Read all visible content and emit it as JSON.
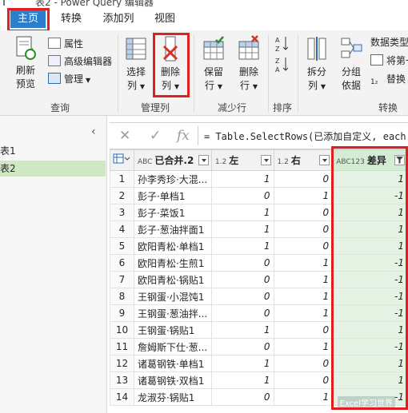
{
  "window": {
    "title": "表2 - Power Query 编辑器"
  },
  "tabs": [
    {
      "label": "主页",
      "active": true
    },
    {
      "label": "转换",
      "active": false
    },
    {
      "label": "添加列",
      "active": false
    },
    {
      "label": "视图",
      "active": false
    }
  ],
  "ribbon": {
    "refresh_line1": "刷新",
    "refresh_line2": "预览",
    "properties": "属性",
    "advanced_editor": "高级编辑器",
    "manage": "管理",
    "group_query": "查询",
    "choose_line1": "选择",
    "choose_line2": "列",
    "remove_line1": "删除",
    "remove_line2": "列",
    "group_manage_columns": "管理列",
    "keep_line1": "保留",
    "keep_line2": "行",
    "delete_line1": "删除",
    "delete_line2": "行",
    "group_reduce_rows": "减少行",
    "group_sort": "排序",
    "split_line1": "拆分",
    "split_line2": "列",
    "groupby_line1": "分组",
    "groupby_line2": "依据",
    "datatype": "数据类型",
    "firstrow": "将第一",
    "replace": "替换",
    "group_transform": "转换"
  },
  "queries": [
    {
      "label": "表1",
      "selected": false
    },
    {
      "label": "表2",
      "selected": true
    }
  ],
  "formula": {
    "text": "= Table.SelectRows(已添加自定义, each ("
  },
  "grid": {
    "columns": [
      {
        "type": "ABC",
        "name": "已合并.2"
      },
      {
        "type": "1.2",
        "name": "左"
      },
      {
        "type": "1.2",
        "name": "右"
      },
      {
        "type": "ABC123",
        "name": "差异"
      }
    ],
    "rows": [
      {
        "n": "1",
        "name": "孙李秀珍·大混...",
        "left": "1",
        "right": "0",
        "diff": "1"
      },
      {
        "n": "2",
        "name": "彭子·单档1",
        "left": "0",
        "right": "1",
        "diff": "-1"
      },
      {
        "n": "3",
        "name": "彭子·菜饭1",
        "left": "1",
        "right": "0",
        "diff": "1"
      },
      {
        "n": "4",
        "name": "彭子·葱油拌面1",
        "left": "1",
        "right": "0",
        "diff": "1"
      },
      {
        "n": "5",
        "name": "欧阳青松·单档1",
        "left": "1",
        "right": "0",
        "diff": "1"
      },
      {
        "n": "6",
        "name": "欧阳青松·生煎1",
        "left": "0",
        "right": "1",
        "diff": "-1"
      },
      {
        "n": "7",
        "name": "欧阳青松·锅贴1",
        "left": "0",
        "right": "1",
        "diff": "-1"
      },
      {
        "n": "8",
        "name": "王钢蛋·小混饨1",
        "left": "0",
        "right": "1",
        "diff": "-1"
      },
      {
        "n": "9",
        "name": "王钢蛋·葱油拌...",
        "left": "0",
        "right": "1",
        "diff": "-1"
      },
      {
        "n": "10",
        "name": "王钢蛋·锅贴1",
        "left": "1",
        "right": "0",
        "diff": "1"
      },
      {
        "n": "11",
        "name": "詹姆斯下仕·葱...",
        "left": "0",
        "right": "1",
        "diff": "-1"
      },
      {
        "n": "12",
        "name": "诸葛钢铁·单档1",
        "left": "1",
        "right": "0",
        "diff": "1"
      },
      {
        "n": "13",
        "name": "诸葛钢铁·双档1",
        "left": "1",
        "right": "0",
        "diff": "1"
      },
      {
        "n": "14",
        "name": "龙淑芬·锅贴1",
        "left": "0",
        "right": "1",
        "diff": "-1"
      }
    ]
  },
  "watermark": "Excel学习世界"
}
